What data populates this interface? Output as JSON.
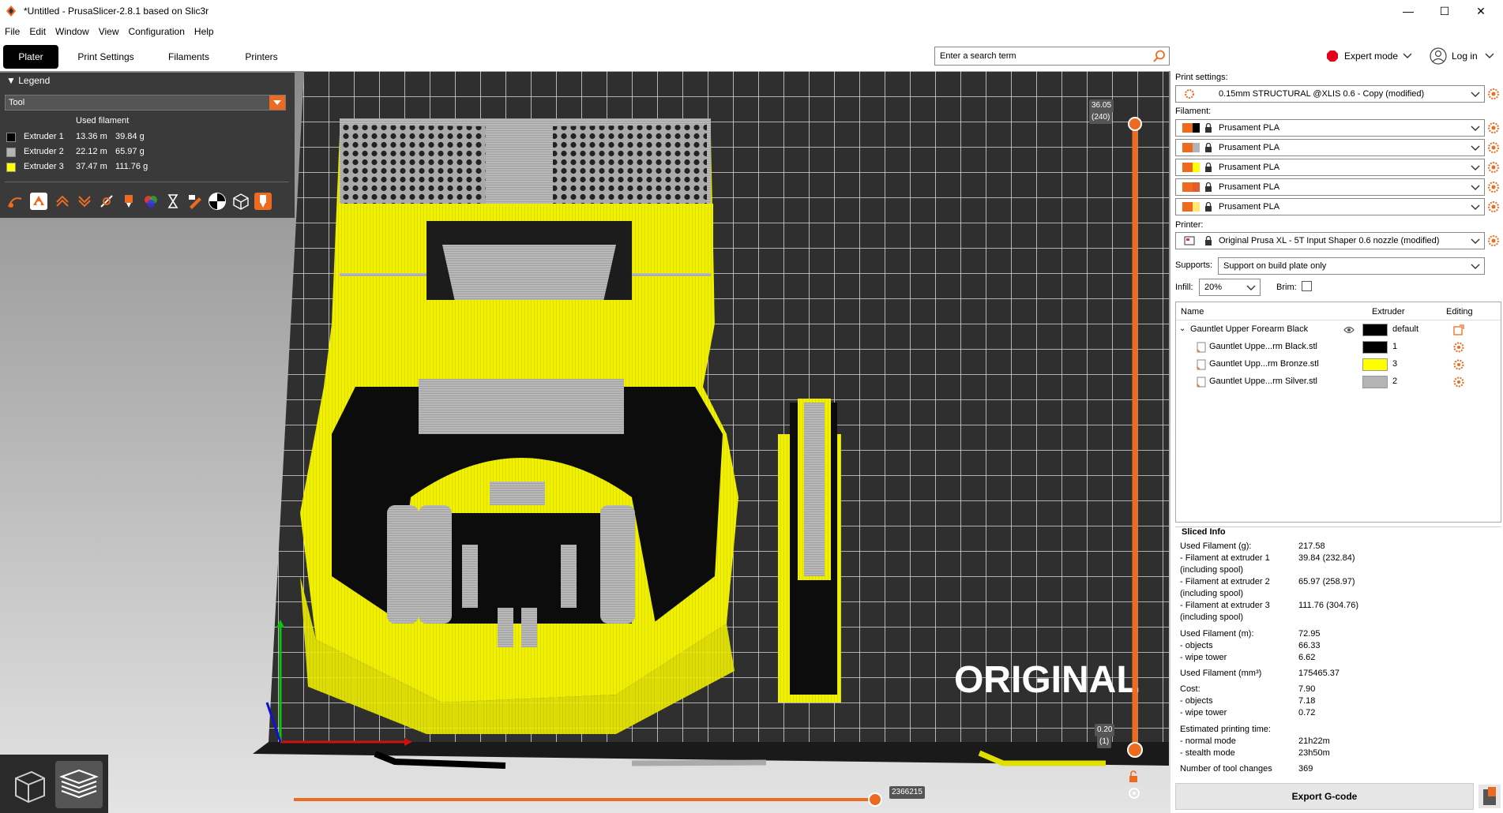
{
  "window": {
    "title": "*Untitled - PrusaSlicer-2.8.1 based on Slic3r",
    "minimize": "—",
    "maximize": "☐",
    "close": "✕"
  },
  "menu": [
    "File",
    "Edit",
    "Window",
    "View",
    "Configuration",
    "Help"
  ],
  "tabs": [
    "Plater",
    "Print Settings",
    "Filaments",
    "Printers"
  ],
  "search": {
    "placeholder": "Enter a search term"
  },
  "mode": {
    "label": "Expert mode",
    "color": "#e3001b"
  },
  "login": {
    "label": "Log in"
  },
  "legend": {
    "header": "Legend",
    "view_type": "Tool",
    "column": "Used filament",
    "rows": [
      {
        "name": "Extruder 1",
        "length": "13.36 m",
        "weight": "39.84 g",
        "color": "#000000"
      },
      {
        "name": "Extruder 2",
        "length": "22.12 m",
        "weight": "65.97 g",
        "color": "#b4b4b4"
      },
      {
        "name": "Extruder 3",
        "length": "37.47 m",
        "weight": "111.76 g",
        "color": "#ffff00"
      }
    ]
  },
  "viewport": {
    "watermark": "ORIGINAL",
    "vslider_top": "36.05",
    "vslider_top_layer": "(240)",
    "vslider_bottom": "0.20",
    "vslider_bottom_layer": "(1)",
    "hslider_value": "2366215"
  },
  "right": {
    "print_settings_label": "Print settings:",
    "print_profile": "0.15mm STRUCTURAL @XLIS 0.6 - Copy (modified)",
    "filament_label": "Filament:",
    "filaments": [
      {
        "name": "Prusament PLA",
        "swatch": "#000000"
      },
      {
        "name": "Prusament PLA",
        "swatch": "#b4b4b4"
      },
      {
        "name": "Prusament PLA",
        "swatch": "#ffff00"
      },
      {
        "name": "Prusament PLA",
        "swatch": "#e55a2b"
      },
      {
        "name": "Prusament PLA",
        "swatch": "#ffe86b"
      }
    ],
    "printer_label": "Printer:",
    "printer": "Original Prusa XL - 5T Input Shaper 0.6 nozzle (modified)",
    "supports_label": "Supports:",
    "supports": "Support on build plate only",
    "infill_label": "Infill:",
    "infill": "20%",
    "brim_label": "Brim:"
  },
  "objects": {
    "col_name": "Name",
    "col_extruder": "Extruder",
    "col_editing": "Editing",
    "rows": [
      {
        "name": "Gauntlet Upper Forearm Black",
        "extruder": "default",
        "color": "#000000"
      },
      {
        "name": "Gauntlet Uppe...rm Black.stl",
        "extruder": "1",
        "color": "#000000"
      },
      {
        "name": "Gauntlet Upp...rm Bronze.stl",
        "extruder": "3",
        "color": "#ffff00"
      },
      {
        "name": "Gauntlet Uppe...rm Silver.stl",
        "extruder": "2",
        "color": "#b4b4b4"
      }
    ]
  },
  "sliced": {
    "title": "Sliced Info",
    "rows": [
      {
        "label": "Used Filament (g):",
        "value": "217.58"
      },
      {
        "label": "   - Filament at extruder 1",
        "value": "39.84 (232.84)"
      },
      {
        "label": "     (including spool)",
        "value": ""
      },
      {
        "label": "   - Filament at extruder 2",
        "value": "65.97 (258.97)"
      },
      {
        "label": "     (including spool)",
        "value": ""
      },
      {
        "label": "   - Filament at extruder 3",
        "value": "111.76 (304.76)"
      },
      {
        "label": "     (including spool)",
        "value": ""
      },
      {
        "label": "Used Filament (m):",
        "value": "72.95"
      },
      {
        "label": "   - objects",
        "value": "66.33"
      },
      {
        "label": "   - wipe tower",
        "value": "6.62"
      },
      {
        "label": "Used Filament (mm³)",
        "value": "175465.37"
      },
      {
        "label": "Cost:",
        "value": "7.90"
      },
      {
        "label": "   - objects",
        "value": "7.18"
      },
      {
        "label": "   - wipe tower",
        "value": "0.72"
      },
      {
        "label": "Estimated printing time:",
        "value": ""
      },
      {
        "label": "   - normal mode",
        "value": "21h22m"
      },
      {
        "label": "   - stealth mode",
        "value": "23h50m"
      },
      {
        "label": "Number of tool changes",
        "value": "369"
      }
    ]
  },
  "export_label": "Export G-code",
  "accent": "#ed6b21"
}
